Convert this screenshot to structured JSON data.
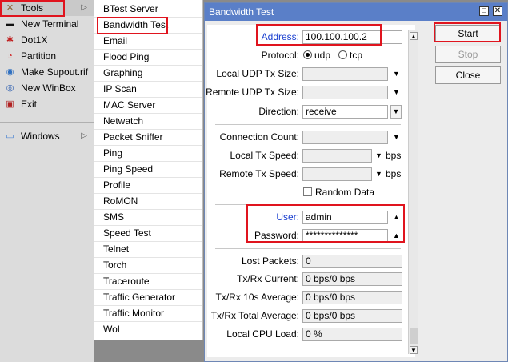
{
  "left_menu": {
    "items": [
      {
        "label": "Tools",
        "icon": "tools-icon",
        "glyph": "✕",
        "color": "#8a5a2a"
      },
      {
        "label": "New Terminal",
        "icon": "terminal-icon",
        "glyph": "▬",
        "color": "#111111"
      },
      {
        "label": "Dot1X",
        "icon": "dot1x-icon",
        "glyph": "✱",
        "color": "#c02020"
      },
      {
        "label": "Partition",
        "icon": "partition-icon",
        "glyph": "◔",
        "color": "#d03030"
      },
      {
        "label": "Make Supout.rif",
        "icon": "supout-icon",
        "glyph": "◉",
        "color": "#3070c0"
      },
      {
        "label": "New WinBox",
        "icon": "winbox-icon",
        "glyph": "◎",
        "color": "#3060b0"
      },
      {
        "label": "Exit",
        "icon": "exit-icon",
        "glyph": "▣",
        "color": "#b02020"
      }
    ],
    "windows": {
      "label": "Windows",
      "icon": "windows-icon",
      "glyph": "▭",
      "color": "#3a7ad0"
    },
    "submenu_arrow": "▷"
  },
  "tools_submenu": [
    "BTest Server",
    "Bandwidth Test",
    "Email",
    "Flood Ping",
    "Graphing",
    "IP Scan",
    "MAC Server",
    "Netwatch",
    "Packet Sniffer",
    "Ping",
    "Ping Speed",
    "Profile",
    "RoMON",
    "SMS",
    "Speed Test",
    "Telnet",
    "Torch",
    "Traceroute",
    "Traffic Generator",
    "Traffic Monitor",
    "WoL"
  ],
  "dialog": {
    "title": "Bandwidth Test",
    "maximize_glyph": "□",
    "close_glyph": "✕",
    "address": {
      "label": "Address:",
      "value": "100.100.100.2"
    },
    "protocol": {
      "label": "Protocol:",
      "options": [
        "udp",
        "tcp"
      ],
      "selected": "udp"
    },
    "local_udp_tx_size": {
      "label": "Local UDP Tx Size:",
      "value": ""
    },
    "remote_udp_tx_size": {
      "label": "Remote UDP Tx Size:",
      "value": ""
    },
    "direction": {
      "label": "Direction:",
      "value": "receive"
    },
    "connection_count": {
      "label": "Connection Count:",
      "value": ""
    },
    "local_tx_speed": {
      "label": "Local Tx Speed:",
      "value": "",
      "unit": "bps"
    },
    "remote_tx_speed": {
      "label": "Remote Tx Speed:",
      "value": "",
      "unit": "bps"
    },
    "random_data": {
      "label": "Random Data",
      "checked": false
    },
    "user": {
      "label": "User:",
      "value": "admin"
    },
    "password": {
      "label": "Password:",
      "value": "**************"
    },
    "lost_packets": {
      "label": "Lost Packets:",
      "value": "0"
    },
    "txrx_current": {
      "label": "Tx/Rx Current:",
      "value": "0 bps/0 bps"
    },
    "txrx_10s": {
      "label": "Tx/Rx 10s Average:",
      "value": "0 bps/0 bps"
    },
    "txrx_total": {
      "label": "Tx/Rx Total Average:",
      "value": "0 bps/0 bps"
    },
    "cpu_load": {
      "label": "Local CPU Load:",
      "value": "0 %"
    },
    "buttons": {
      "start": "Start",
      "stop": "Stop",
      "close": "Close"
    },
    "glyphs": {
      "dropdown": "▼",
      "up": "▲",
      "scroll_up": "▲",
      "scroll_down": "▼"
    }
  },
  "colors": {
    "highlight_red": "#e0141e",
    "title_blue": "#5a7fc8",
    "label_blue": "#1a3fd0"
  }
}
